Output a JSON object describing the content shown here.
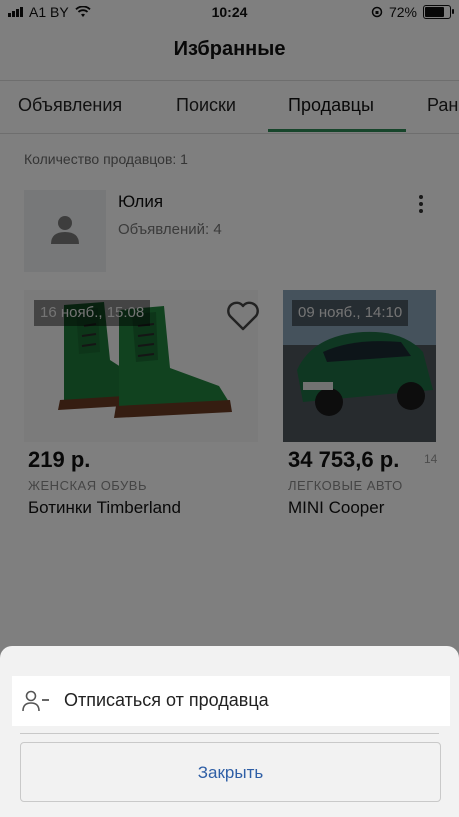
{
  "status_bar": {
    "carrier": "A1 BY",
    "time": "10:24",
    "battery": "72%",
    "battery_level": 0.72
  },
  "nav": {
    "title": "Избранные"
  },
  "tabs": [
    {
      "label": "Объявления"
    },
    {
      "label": "Поиски"
    },
    {
      "label": "Продавцы"
    },
    {
      "label": "Ран"
    }
  ],
  "sellers": {
    "count_label": "Количество продавцов: 1",
    "name": "Юлия",
    "ads_label": "Объявлений: 4"
  },
  "items": [
    {
      "date": "16 нояб., 15:08",
      "price": "219 р.",
      "category": "ЖЕНСКАЯ ОБУВЬ",
      "name": "Ботинки Timberland"
    },
    {
      "date": "09 нояб., 14:10",
      "price": "34 753,6 р.",
      "category": "ЛЕГКОВЫЕ АВТО",
      "name": "MINI Cooper",
      "price_extra": "14"
    }
  ],
  "sheet": {
    "unsubscribe_label": "Отписаться от продавца",
    "close_label": "Закрыть"
  },
  "colors": {
    "accent": "#2e8b57",
    "link": "#2f5fa6",
    "shoe_green": "#1f7a3a"
  }
}
